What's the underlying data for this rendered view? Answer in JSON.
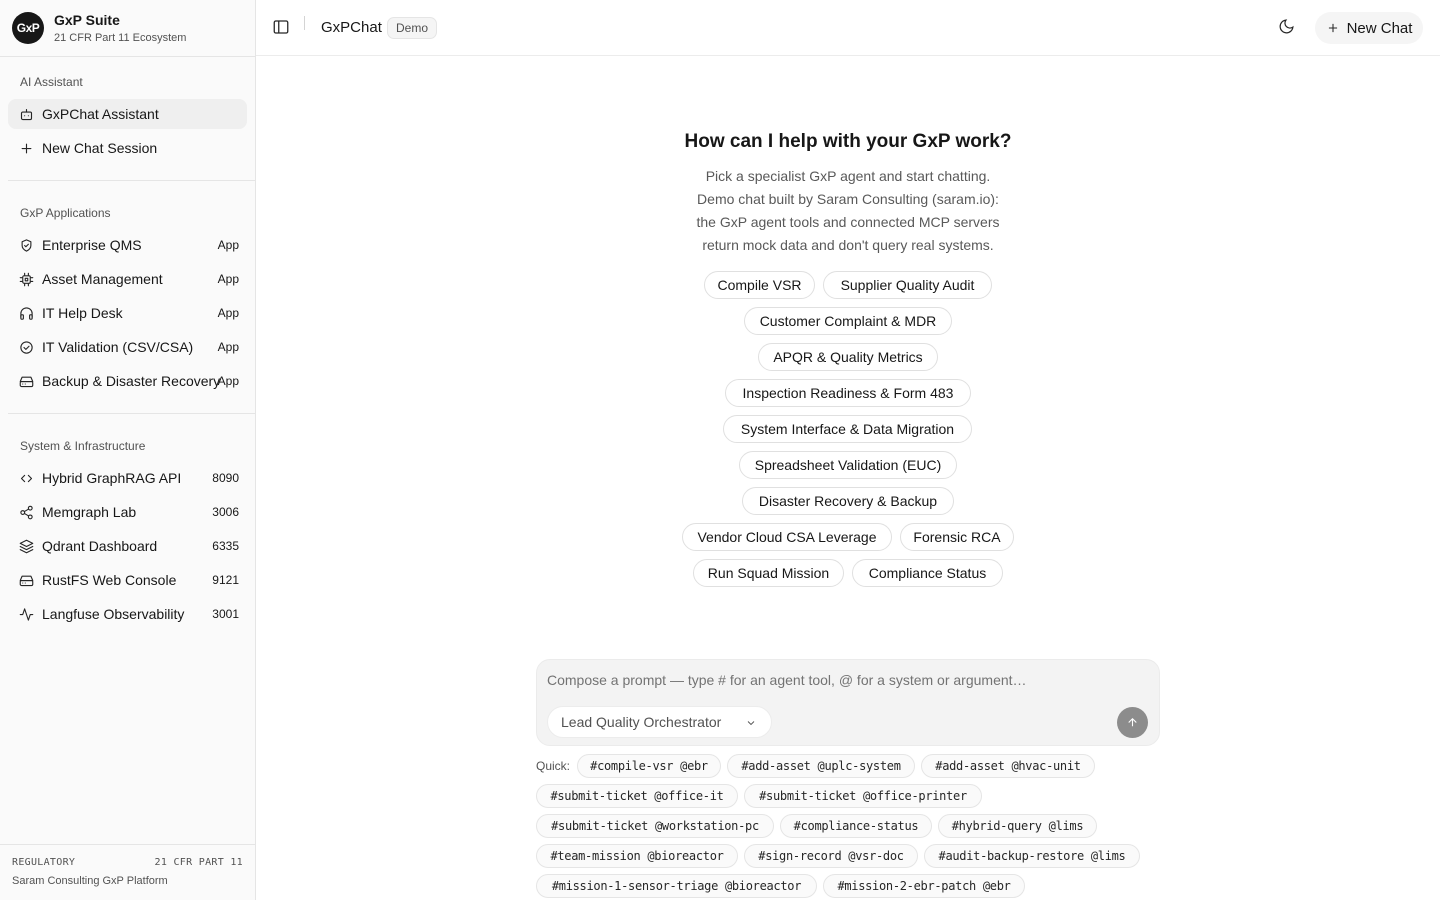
{
  "sidebar": {
    "brand": {
      "logo": "GxP",
      "title": "GxP Suite",
      "subtitle": "21 CFR Part 11 Ecosystem"
    },
    "groups": [
      {
        "label": "AI Assistant",
        "items": [
          {
            "label": "GxPChat Assistant",
            "icon": "bot-icon",
            "badge": ""
          },
          {
            "label": "New Chat Session",
            "icon": "plus-icon",
            "badge": ""
          }
        ]
      },
      {
        "label": "GxP Applications",
        "items": [
          {
            "label": "Enterprise QMS",
            "icon": "shield-check-icon",
            "badge": "App"
          },
          {
            "label": "Asset Management",
            "icon": "cpu-icon",
            "badge": "App"
          },
          {
            "label": "IT Help Desk",
            "icon": "headphones-icon",
            "badge": "App"
          },
          {
            "label": "IT Validation (CSV/CSA)",
            "icon": "check-circle-icon",
            "badge": "App"
          },
          {
            "label": "Backup & Disaster Recovery",
            "icon": "hard-drive-icon",
            "badge": "App"
          }
        ]
      },
      {
        "label": "System & Infrastructure",
        "items": [
          {
            "label": "Hybrid GraphRAG API",
            "icon": "code-icon",
            "badge": "8090"
          },
          {
            "label": "Memgraph Lab",
            "icon": "share-icon",
            "badge": "3006"
          },
          {
            "label": "Qdrant Dashboard",
            "icon": "layers-icon",
            "badge": "6335"
          },
          {
            "label": "RustFS Web Console",
            "icon": "hard-drive-icon",
            "badge": "9121"
          },
          {
            "label": "Langfuse Observability",
            "icon": "activity-icon",
            "badge": "3001"
          }
        ]
      }
    ],
    "footer": {
      "regulatory": "REGULATORY",
      "part": "21 CFR PART 11",
      "platform": "Saram Consulting GxP Platform"
    }
  },
  "header": {
    "title": "GxPChat",
    "badge": "Demo",
    "new_chat": "New Chat"
  },
  "hero": {
    "title": "How can I help with your GxP work?",
    "description": [
      "Pick a specialist GxP agent and start chatting.",
      "Demo chat built by Saram Consulting (saram.io):",
      "the GxP agent tools and connected MCP servers",
      "return mock data and don't query real systems."
    ]
  },
  "suggestions": [
    "Compile VSR",
    "Supplier Quality Audit",
    "Customer Complaint & MDR",
    "APQR & Quality Metrics",
    "Inspection Readiness & Form 483",
    "System Interface & Data Migration",
    "Spreadsheet Validation (EUC)",
    "Disaster Recovery & Backup",
    "Vendor Cloud CSA Leverage",
    "Forensic RCA",
    "Run Squad Mission",
    "Compliance Status"
  ],
  "composer": {
    "placeholder": "Compose a prompt — type # for an agent tool, @ for a system or argument…",
    "value": "",
    "agent": "Lead Quality Orchestrator"
  },
  "quick": {
    "label": "Quick:",
    "chips": [
      "#compile-vsr @ebr",
      "#add-asset @uplc-system",
      "#add-asset @hvac-unit",
      "#submit-ticket @office-it",
      "#submit-ticket @office-printer",
      "#submit-ticket @workstation-pc",
      "#compliance-status",
      "#hybrid-query @lims",
      "#team-mission @bioreactor",
      "#sign-record @vsr-doc",
      "#audit-backup-restore @lims",
      "#mission-1-sensor-triage @bioreactor",
      "#mission-2-ebr-patch @ebr"
    ]
  }
}
